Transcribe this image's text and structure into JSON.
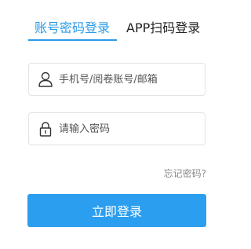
{
  "tabs": {
    "active_label": "账号密码登录",
    "inactive_label": "APP扫码登录"
  },
  "form": {
    "username_placeholder": "手机号/阅卷账号/邮箱",
    "password_placeholder": "请输入密码",
    "forgot_label": "忘记密码?",
    "login_label": "立即登录"
  },
  "icons": {
    "user": "user-icon",
    "password": "lock-icon"
  },
  "colors": {
    "accent": "#2a9ae8",
    "button": "#2c9ef0",
    "border": "#e3e3e3"
  }
}
